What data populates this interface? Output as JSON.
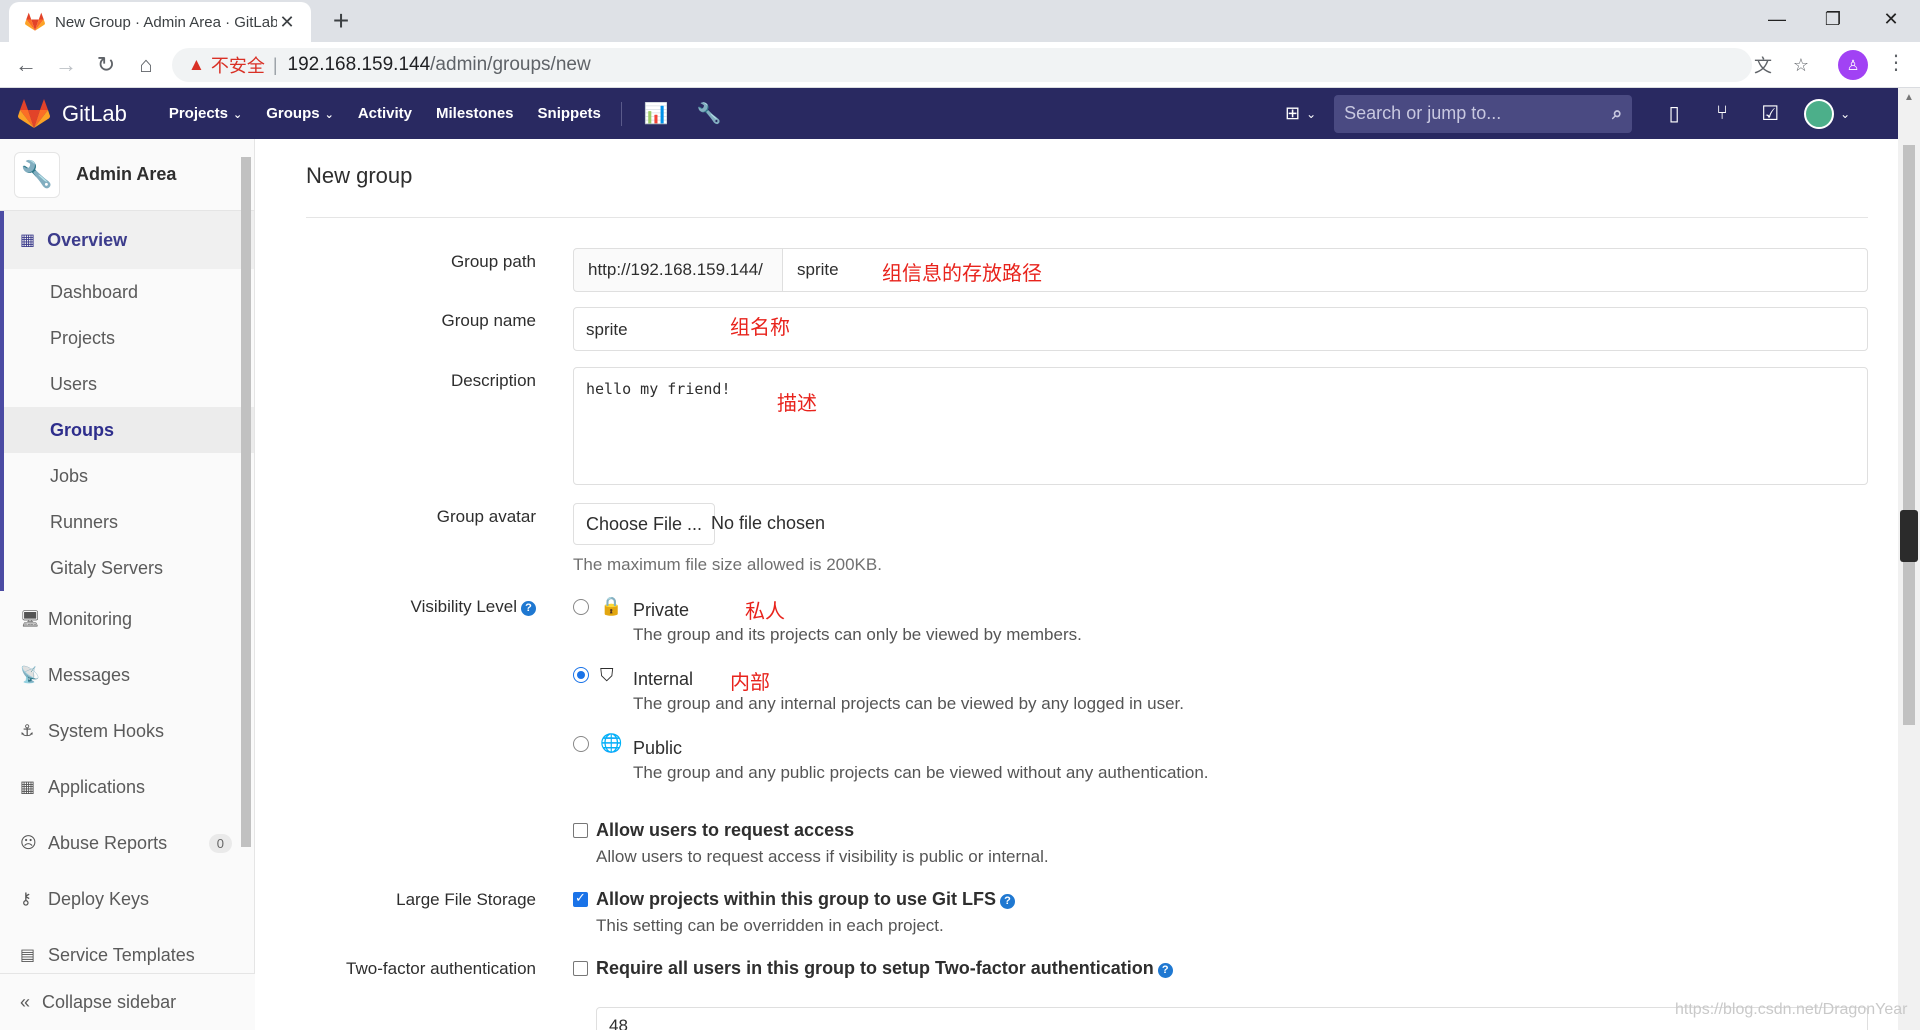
{
  "browser": {
    "tab_title": "New Group · Admin Area · GitLab",
    "tab_close": "✕",
    "new_tab": "+",
    "insecure_label": "不安全",
    "url_host": "192.168.159.144",
    "url_path": "/admin/groups/new",
    "profile_initial": "♙"
  },
  "header": {
    "brand": "GitLab",
    "nav": [
      {
        "label": "Projects",
        "dropdown": true
      },
      {
        "label": "Groups",
        "dropdown": true
      },
      {
        "label": "Activity",
        "dropdown": false
      },
      {
        "label": "Milestones",
        "dropdown": false
      },
      {
        "label": "Snippets",
        "dropdown": false
      }
    ],
    "search_placeholder": "Search or jump to..."
  },
  "sidebar": {
    "title": "Admin Area",
    "overview_label": "Overview",
    "overview_items": [
      "Dashboard",
      "Projects",
      "Users",
      "Groups",
      "Jobs",
      "Runners",
      "Gitaly Servers"
    ],
    "active_item": "Groups",
    "items": [
      {
        "label": "Monitoring",
        "icon": "monitor-icon"
      },
      {
        "label": "Messages",
        "icon": "broadcast-icon"
      },
      {
        "label": "System Hooks",
        "icon": "hook-icon"
      },
      {
        "label": "Applications",
        "icon": "applications-icon"
      },
      {
        "label": "Abuse Reports",
        "icon": "abuse-icon",
        "badge": "0"
      },
      {
        "label": "Deploy Keys",
        "icon": "key-icon"
      },
      {
        "label": "Service Templates",
        "icon": "template-icon"
      }
    ],
    "collapse_label": "Collapse sidebar"
  },
  "form": {
    "page_title": "New group",
    "group_path_label": "Group path",
    "group_path_prefix": "http://192.168.159.144/",
    "group_path_value": "sprite",
    "group_path_note": "组信息的存放路径",
    "group_name_label": "Group name",
    "group_name_value": "sprite",
    "group_name_note": "组名称",
    "description_label": "Description",
    "description_value": "hello my friend!",
    "description_note": "描述",
    "avatar_label": "Group avatar",
    "choose_file": "Choose File ...",
    "no_file": "No file chosen",
    "avatar_help": "The maximum file size allowed is 200KB.",
    "visibility_label": "Visibility Level",
    "visibility_options": [
      {
        "label": "Private",
        "note": "私人",
        "desc": "The group and its projects can only be viewed by members.",
        "selected": false
      },
      {
        "label": "Internal",
        "note": "内部",
        "desc": "The group and any internal projects can be viewed by any logged in user.",
        "selected": true
      },
      {
        "label": "Public",
        "note": "",
        "desc": "The group and any public projects can be viewed without any authentication.",
        "selected": false
      }
    ],
    "request_access_label": "Allow users to request access",
    "request_access_desc": "Allow users to request access if visibility is public or internal.",
    "request_access_checked": false,
    "lfs_label": "Large File Storage",
    "lfs_check_label": "Allow projects within this group to use Git LFS",
    "lfs_desc": "This setting can be overridden in each project.",
    "lfs_checked": true,
    "twofa_label": "Two-factor authentication",
    "twofa_check_label": "Require all users in this group to setup Two-factor authentication",
    "twofa_checked": false,
    "grace_value": "48"
  },
  "watermark": "https://blog.csdn.net/DragonYear",
  "colors": {
    "header": "#292961",
    "accent": "#1f78d1",
    "annotation": "#e8231c"
  }
}
